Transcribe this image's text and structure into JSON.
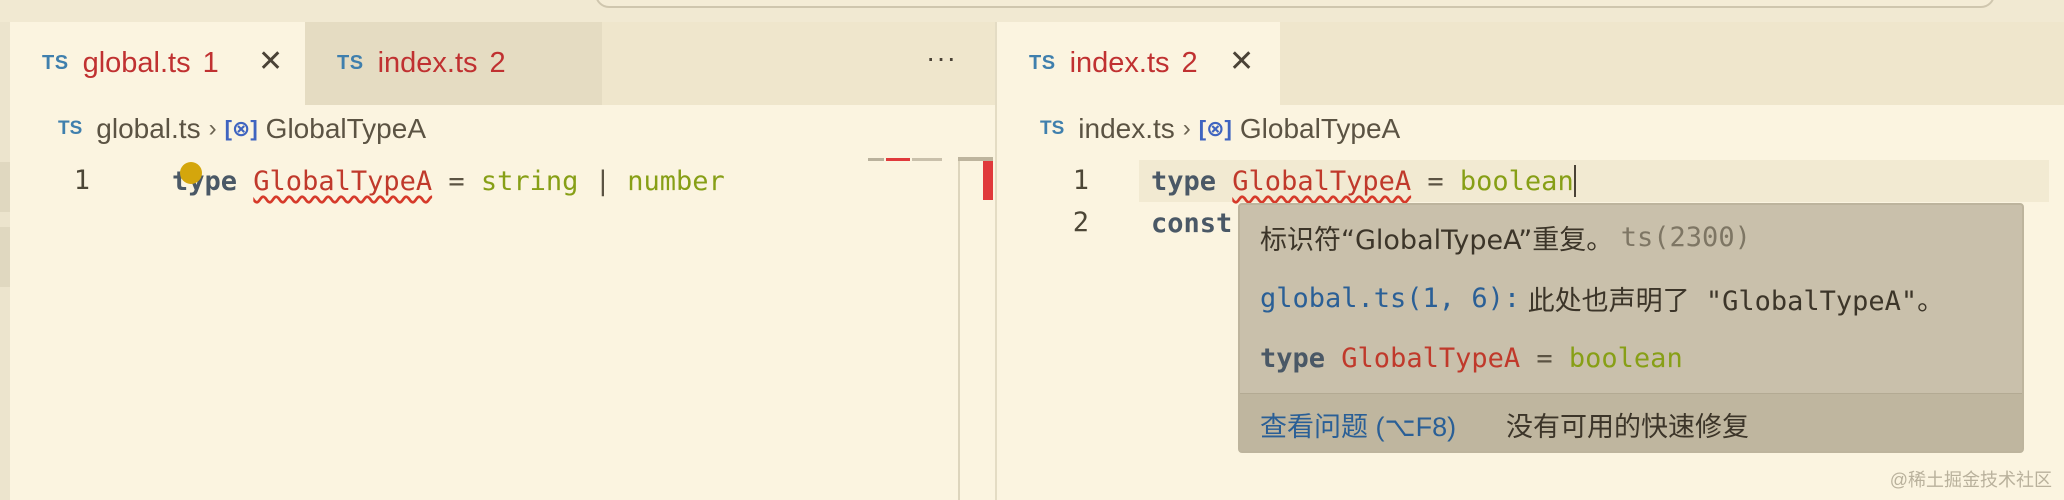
{
  "left_pane": {
    "tabs": [
      {
        "lang": "TS",
        "name": "global.ts",
        "count": "1",
        "close": "✕"
      },
      {
        "lang": "TS",
        "name": "index.ts",
        "count": "2"
      }
    ],
    "more": "···",
    "breadcrumb": {
      "lang": "TS",
      "file": "global.ts",
      "separator": "›",
      "symbol_icon": "symbol-type-icon",
      "symbol": "GlobalTypeA"
    },
    "lines": [
      {
        "number": "1",
        "keyword": "type",
        "name": "GlobalTypeA",
        "eq": "=",
        "type1": "string",
        "pipe": "|",
        "type2": "number"
      }
    ]
  },
  "right_pane": {
    "tab": {
      "lang": "TS",
      "name": "index.ts",
      "count": "2",
      "close": "✕"
    },
    "breadcrumb": {
      "lang": "TS",
      "file": "index.ts",
      "separator": "›",
      "symbol_icon": "symbol-type-icon",
      "symbol": "GlobalTypeA"
    },
    "lines": [
      {
        "number": "1",
        "keyword": "type",
        "name": "GlobalTypeA",
        "eq": "=",
        "value": "boolean"
      },
      {
        "number": "2",
        "keyword": "const"
      }
    ]
  },
  "hover": {
    "message": "标识符“GlobalTypeA”重复。",
    "code": "ts(2300)",
    "related_location": "global.ts(1, 6):",
    "related_message": "此处也声明了 \"GlobalTypeA\"。",
    "preview": {
      "keyword": "type",
      "name": "GlobalTypeA",
      "eq": "=",
      "value": "boolean"
    },
    "view_problem": "查看问题 (⌥F8)",
    "no_fix": "没有可用的快速修复"
  },
  "watermark": "@稀土掘金技术社区",
  "colors": {
    "background": "#fbf4e0",
    "error": "#c03131",
    "keyword": "#4a5866",
    "type": "#879f16",
    "link": "#2a5f96"
  }
}
